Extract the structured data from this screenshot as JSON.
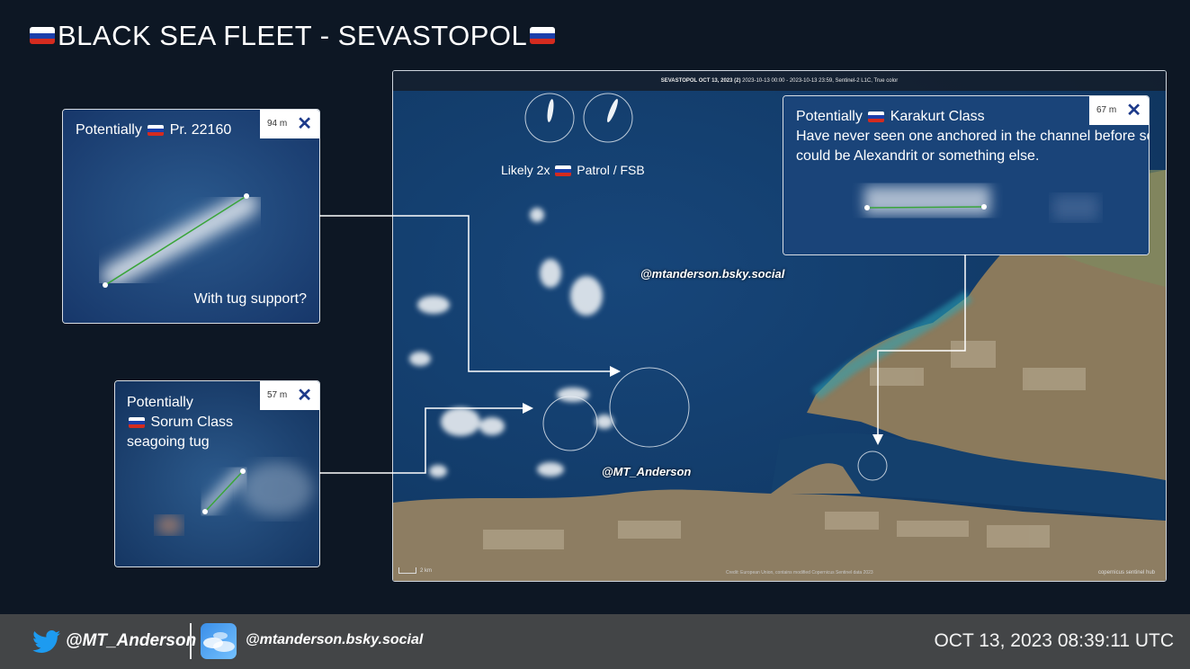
{
  "title": {
    "text": "BLACK SEA FLEET -  SEVASTOPOL"
  },
  "map": {
    "header_bold": "SEVASTOPOL OCT 13, 2023 (2)",
    "header_rest": " 2023-10-13 00:00 - 2023-10-13 23:59, Sentinel-2 L1C, True color",
    "patrol_label": "Likely 2x",
    "patrol_suffix": "Patrol / FSB",
    "bsky_watermark": "@mtanderson.bsky.social",
    "twitter_watermark": "@MT_Anderson",
    "scale": "2 km",
    "credit": "Credit: European Union, contains modified Copernicus Sentinel data 2023",
    "logo": "copernicus  sentinel hub"
  },
  "cards": {
    "pr22160": {
      "line1": "Potentially",
      "line1b": "Pr. 22160",
      "footer": "With tug support?",
      "length": "94 m"
    },
    "sorum": {
      "line1": "Potentially",
      "line2": "Sorum Class",
      "line3": "seagoing tug",
      "length": "57 m"
    },
    "karakurt": {
      "line1": "Potentially",
      "line1b": "Karakurt Class",
      "line2": "Have never seen one anchored in the channel before so",
      "line3": "could be Alexandrit or something else.",
      "length": "67 m"
    }
  },
  "footer": {
    "twitter": "@MT_Anderson",
    "bluesky": "@mtanderson.bsky.social",
    "timestamp": "OCT 13, 2023 08:39:11 UTC"
  },
  "colors": {
    "background": "#0d1724",
    "sea": "#123e6c",
    "footer": "#434547",
    "measure_line": "#3aa53a"
  },
  "icons": {
    "flag": "russian-flag-icon",
    "close": "close-icon",
    "twitter": "twitter-bird-icon",
    "bluesky": "bluesky-icon"
  }
}
